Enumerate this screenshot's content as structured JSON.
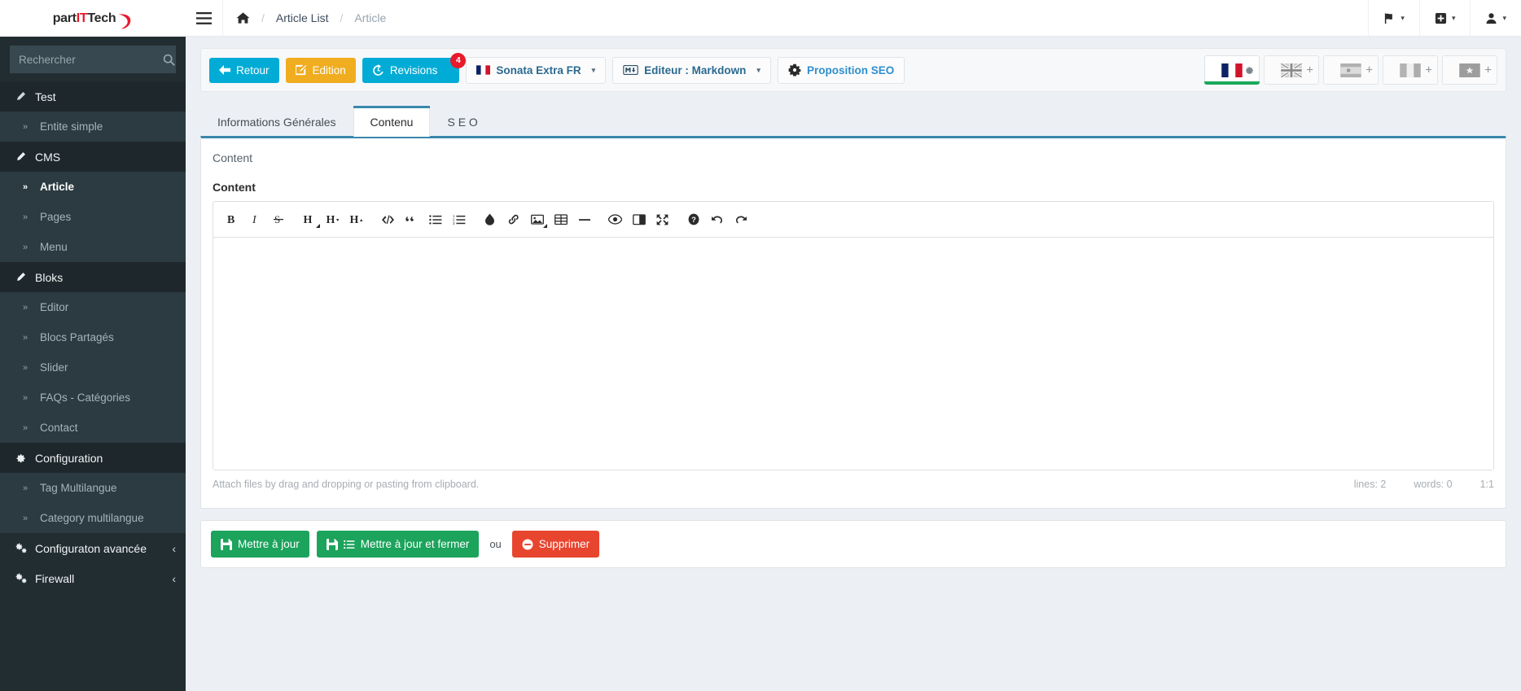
{
  "brand": {
    "name_part1": "part",
    "name_it": "IT",
    "name_part2": "Tech",
    "accent_color": "#e8192c"
  },
  "sidebar": {
    "search": {
      "placeholder": "Rechercher",
      "value": "",
      "icon": "search-icon"
    },
    "items": [
      {
        "label": "Test",
        "type": "header",
        "icon": "pencil-icon",
        "active": false
      },
      {
        "label": "Entite simple",
        "type": "sub",
        "icon": "angle-double-right-icon",
        "active": false
      },
      {
        "label": "CMS",
        "type": "header",
        "icon": "pencil-icon",
        "active": false
      },
      {
        "label": "Article",
        "type": "sub",
        "icon": "angle-double-right-icon",
        "active": true
      },
      {
        "label": "Pages",
        "type": "sub",
        "icon": "angle-double-right-icon",
        "active": false
      },
      {
        "label": "Menu",
        "type": "sub",
        "icon": "angle-double-right-icon",
        "active": false
      },
      {
        "label": "Bloks",
        "type": "header",
        "icon": "pencil-icon",
        "active": false
      },
      {
        "label": "Editor",
        "type": "sub",
        "icon": "angle-double-right-icon",
        "active": false
      },
      {
        "label": "Blocs Partagés",
        "type": "sub",
        "icon": "angle-double-right-icon",
        "active": false
      },
      {
        "label": "Slider",
        "type": "sub",
        "icon": "angle-double-right-icon",
        "active": false
      },
      {
        "label": "FAQs - Catégories",
        "type": "sub",
        "icon": "angle-double-right-icon",
        "active": false
      },
      {
        "label": "Contact",
        "type": "sub",
        "icon": "angle-double-right-icon",
        "active": false
      },
      {
        "label": "Configuration",
        "type": "header",
        "icon": "gear-icon",
        "active": false
      },
      {
        "label": "Tag Multilangue",
        "type": "sub",
        "icon": "angle-double-right-icon",
        "active": false
      },
      {
        "label": "Category multilangue",
        "type": "sub",
        "icon": "angle-double-right-icon",
        "active": false
      },
      {
        "label": "Configuraton avancée",
        "type": "header",
        "icon": "cogs-icon",
        "active": false,
        "caret": "‹"
      },
      {
        "label": "Firewall",
        "type": "header",
        "icon": "cogs-icon",
        "active": false,
        "caret": "‹"
      }
    ]
  },
  "topbar": {
    "menu_toggle_icon": "hamburger-icon",
    "breadcrumb": {
      "home_icon": "home-icon",
      "separator": "/",
      "items": [
        {
          "label": "Article List",
          "current": false
        },
        {
          "label": "Article",
          "current": true
        }
      ]
    },
    "right_actions": [
      {
        "icon": "flag-icon",
        "caret": "▾"
      },
      {
        "icon": "plus-square-icon",
        "caret": "▾"
      },
      {
        "icon": "user-icon",
        "caret": "▾"
      }
    ]
  },
  "action_bar": {
    "back": {
      "label": "Retour",
      "icon": "arrow-left-icon",
      "color": "#00acd6"
    },
    "edit": {
      "label": "Edition",
      "icon": "pencil-square-icon",
      "color": "#f0ad20"
    },
    "revisions": {
      "label": "Revisions",
      "icon": "history-icon",
      "badge": "4",
      "color": "#00acd6",
      "badge_color": "#e8192c"
    },
    "locale_select": {
      "label": "Sonata Extra FR",
      "icon": "flag-fr-icon",
      "caret": "▾"
    },
    "editor_select": {
      "label": "Editeur : Markdown",
      "icon": "markdown-icon",
      "caret": "▾"
    },
    "seo": {
      "label": "Proposition SEO",
      "icon": "seo-gear-icon",
      "color": "#2d8fce"
    },
    "languages": [
      {
        "name": "fr",
        "flag": "flag-france",
        "active": true,
        "action_icon": "gear-icon"
      },
      {
        "name": "en",
        "flag": "flag-uk",
        "active": false,
        "action_icon": "plus-icon"
      },
      {
        "name": "es",
        "flag": "flag-spain",
        "active": false,
        "action_icon": "plus-icon"
      },
      {
        "name": "it",
        "flag": "flag-italy",
        "active": false,
        "action_icon": "plus-icon"
      },
      {
        "name": "ma",
        "flag": "flag-star",
        "active": false,
        "action_icon": "plus-icon"
      }
    ]
  },
  "tabs": [
    {
      "label": "Informations Générales",
      "active": false
    },
    {
      "label": "Contenu",
      "active": true
    },
    {
      "label": "S E O",
      "active": false
    }
  ],
  "panel": {
    "header": "Content",
    "field_label": "Content",
    "textarea_value": "",
    "toolbar": [
      {
        "name": "bold-icon",
        "glyph": "B"
      },
      {
        "name": "italic-icon",
        "glyph": "I"
      },
      {
        "name": "strikethrough-icon",
        "glyph": "S"
      },
      {
        "name": "heading-icon",
        "glyph": "H"
      },
      {
        "name": "heading-smaller-icon",
        "glyph": "H"
      },
      {
        "name": "heading-bigger-icon",
        "glyph": "H"
      },
      {
        "name": "code-icon",
        "glyph": "</>"
      },
      {
        "name": "quote-icon",
        "glyph": "“"
      },
      {
        "name": "unordered-list-icon",
        "glyph": "list"
      },
      {
        "name": "ordered-list-icon",
        "glyph": "list-ol"
      },
      {
        "name": "clean-block-icon",
        "glyph": "eraser"
      },
      {
        "name": "link-icon",
        "glyph": "link"
      },
      {
        "name": "image-icon",
        "glyph": "image"
      },
      {
        "name": "table-icon",
        "glyph": "table"
      },
      {
        "name": "horizontal-rule-icon",
        "glyph": "minus"
      },
      {
        "name": "preview-icon",
        "glyph": "eye"
      },
      {
        "name": "side-by-side-icon",
        "glyph": "columns"
      },
      {
        "name": "fullscreen-icon",
        "glyph": "arrows-alt"
      },
      {
        "name": "help-icon",
        "glyph": "question"
      },
      {
        "name": "undo-icon",
        "glyph": "undo"
      },
      {
        "name": "redo-icon",
        "glyph": "redo"
      }
    ],
    "status": {
      "hint": "Attach files by drag and dropping or pasting from clipboard.",
      "lines": "lines: 2",
      "words": "words: 0",
      "cursor": "1:1"
    }
  },
  "form_actions": {
    "update": {
      "label": "Mettre à jour",
      "icon": "save-icon",
      "color": "#1ca35c"
    },
    "update_close": {
      "label": "Mettre à jour et fermer",
      "icon": "save-list-icon",
      "color": "#1ca35c"
    },
    "or": "ou",
    "delete": {
      "label": "Supprimer",
      "icon": "minus-circle-icon",
      "color": "#e8452f"
    }
  }
}
